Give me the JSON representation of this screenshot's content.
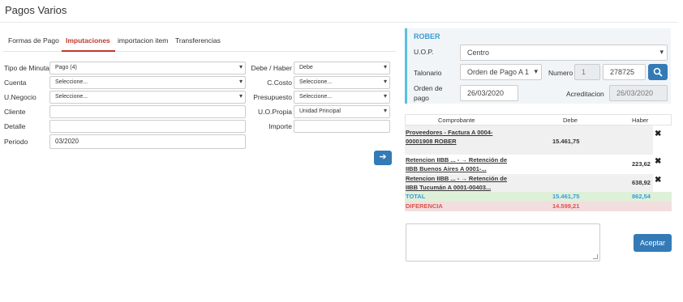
{
  "page": {
    "title": "Pagos Varios"
  },
  "tabs": [
    {
      "label": "Formas de Pago"
    },
    {
      "label": "Imputaciones"
    },
    {
      "label": "importacion item"
    },
    {
      "label": "Transferencias"
    }
  ],
  "form_left": {
    "tipo_minuta": {
      "label": "Tipo de Minuta",
      "value": "Pago (4)"
    },
    "cuenta": {
      "label": "Cuenta",
      "value": "Seleccione..."
    },
    "u_negocio": {
      "label": "U.Negocio",
      "value": "Seleccione..."
    },
    "cliente": {
      "label": "Cliente",
      "value": ""
    },
    "detalle": {
      "label": "Detalle",
      "value": ""
    },
    "periodo": {
      "label": "Periodo",
      "value": "03/2020"
    }
  },
  "form_right": {
    "debe_haber": {
      "label": "Debe / Haber",
      "value": "Debe"
    },
    "c_costo": {
      "label": "C.Costo",
      "value": "Seleccione..."
    },
    "presupuesto": {
      "label": "Presupuesto",
      "value": "Seleccione..."
    },
    "uo_propia": {
      "label": "U.O.Propia",
      "value": "Unidad Principal"
    },
    "importe": {
      "label": "Importe",
      "value": ""
    }
  },
  "go_button": {
    "icon": "arrow-right-icon",
    "glyph": "➔"
  },
  "panel": {
    "title": "ROBER",
    "uop": {
      "label": "U.O.P.",
      "value": "Centro"
    },
    "talonario": {
      "label": "Talonario",
      "value": "Orden de Pago A 1"
    },
    "numero": {
      "label": "Numero",
      "prefix": "1",
      "value": "278725"
    },
    "orden_de_pago": {
      "label_line1": "Orden de",
      "label_line2": "pago",
      "value": "26/03/2020"
    },
    "acreditacion": {
      "label": "Acreditacion",
      "value": "26/03/2020"
    }
  },
  "grid": {
    "headers": {
      "comprobante": "Comprobante",
      "debe": "Debe",
      "haber": "Haber"
    },
    "rows": [
      {
        "line1": "Proveedores - Factura A 0004-",
        "line2": "00001908 ROBER",
        "debe": "15.461,75",
        "haber": ""
      },
      {
        "line1": "Retencion IIBB ... - → Retención de",
        "line2": "IIBB Buenos Aires A 0001-...",
        "debe": "",
        "haber": "223,62"
      },
      {
        "line1": "Retencion IIBB ... - → Retención de",
        "line2": "IIBB Tucumán A 0001-00403...",
        "debe": "",
        "haber": "638,92"
      }
    ],
    "total": {
      "label": "TOTAL",
      "debe": "15.461,75",
      "haber": "862,54"
    },
    "diferencia": {
      "label": "DIFERENCIA",
      "debe": "14.599,21"
    },
    "delete_glyph": "✖"
  },
  "notes": {
    "value": ""
  },
  "accept_button": {
    "label": "Aceptar"
  },
  "colors": {
    "accent_tab": "#c0392b",
    "primary_button": "#337ab7",
    "panel_border": "#5bc0de",
    "total_bg": "#dff0d8",
    "total_text": "#3a9ad9",
    "diferencia_bg": "#f2dede",
    "diferencia_text": "#d9534f"
  }
}
